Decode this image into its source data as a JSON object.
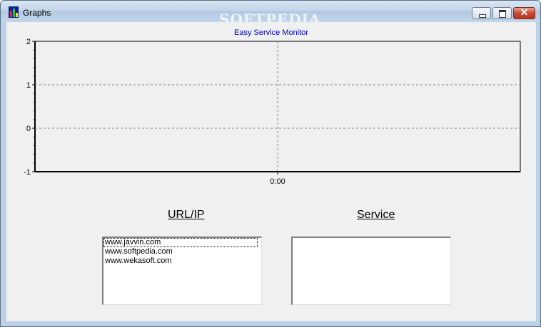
{
  "window": {
    "title": "Graphs",
    "watermark": "SOFTPEDIA",
    "close_glyph": "✕"
  },
  "chart_data": {
    "type": "line",
    "title": "Easy Service Monitor",
    "xlabel": "",
    "ylabel": "",
    "y_ticks": [
      "2",
      "1",
      "0",
      "-1"
    ],
    "ylim": [
      -1,
      2
    ],
    "x_ticks": [
      "0:00"
    ],
    "grid": true,
    "series": []
  },
  "panels": {
    "url_label": "URL/IP",
    "service_label": "Service",
    "urls": [
      "www.javvin.com",
      "www.softpedia.com",
      "www.wekasoft.com"
    ],
    "services": []
  },
  "icons": {
    "app": "bar-chart-icon",
    "minimize": "minimize-icon",
    "maximize": "maximize-icon",
    "close": "close-icon"
  },
  "colors": {
    "chart_title": "#0000c0",
    "grid": "#808080",
    "plot_background": "#f0f0f0"
  }
}
